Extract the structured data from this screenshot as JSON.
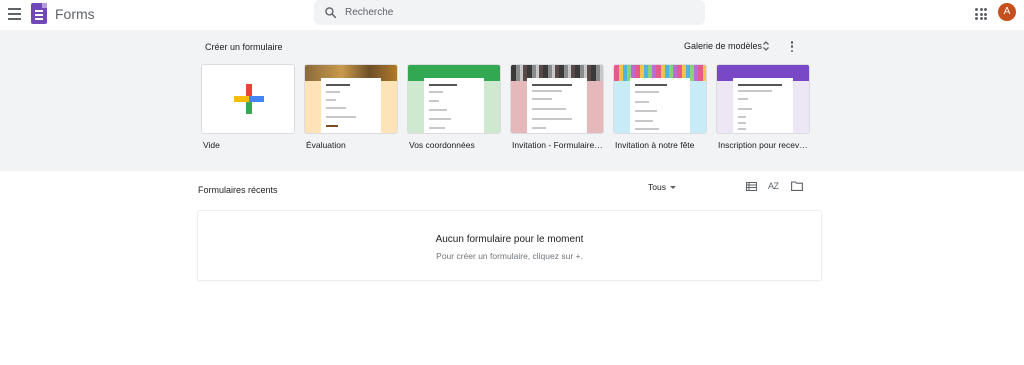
{
  "header": {
    "app_title": "Forms",
    "search_placeholder": "Recherche",
    "avatar_initial": "A",
    "icons": {
      "menu": "hamburger-icon",
      "search": "search-icon",
      "apps": "apps-grid-icon"
    }
  },
  "gallery": {
    "title": "Créer un formulaire",
    "gallery_button": "Galerie de modèles",
    "templates": [
      {
        "label": "Vide",
        "theme": "blank"
      },
      {
        "label": "Évaluation",
        "theme": "#f9c57c"
      },
      {
        "label": "Vos coordonnées",
        "theme": "#33a852"
      },
      {
        "label": "Invitation - Formulaire de réponse",
        "theme": "#d68f95"
      },
      {
        "label": "Invitation à notre fête",
        "theme": "#bde8f6"
      },
      {
        "label": "Inscription pour recevoir un t-shirt",
        "theme": "#7848c6"
      }
    ],
    "accent_colors": {
      "gallery_bg": "#f1f3f4",
      "brand": "#7248b9"
    }
  },
  "recent": {
    "title": "Formulaires récents",
    "filter_label": "Tous",
    "sort_label": "AZ",
    "empty_title": "Aucun formulaire pour le moment",
    "empty_subtitle": "Pour créer un formulaire, cliquez sur +."
  }
}
